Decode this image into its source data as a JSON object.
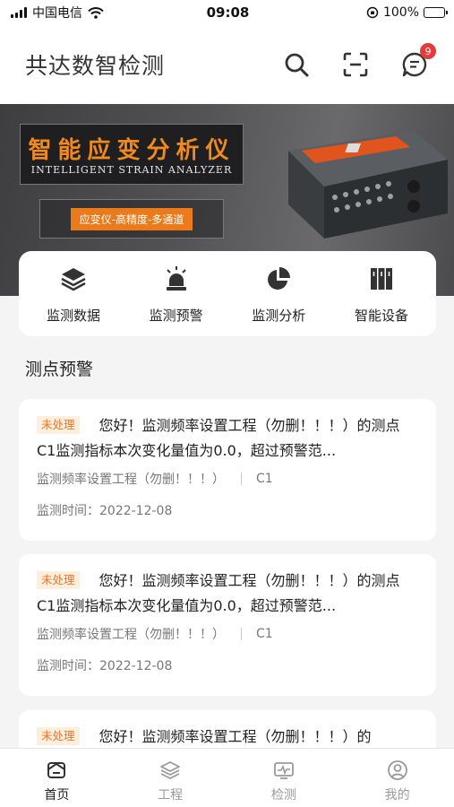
{
  "status_bar": {
    "carrier": "中国电信",
    "time": "09:08",
    "battery_pct": "100%",
    "battery_level": 1.0
  },
  "header": {
    "title": "共达数智检测",
    "notification_badge": "9",
    "icons": [
      "search-icon",
      "scan-icon",
      "message-icon"
    ]
  },
  "banner": {
    "title": "智能应变分析仪",
    "subtitle": "INTELLIGENT STRAIN ANALYZER",
    "tag": "应变仪-高精度-多通道"
  },
  "quick_nav": [
    {
      "label": "监测数据",
      "icon": "layers-icon"
    },
    {
      "label": "监测预警",
      "icon": "alarm-light-icon"
    },
    {
      "label": "监测分析",
      "icon": "pie-chart-icon"
    },
    {
      "label": "智能设备",
      "icon": "device-cabinet-icon"
    }
  ],
  "section": {
    "title": "测点预警"
  },
  "alerts": [
    {
      "status": "未处理",
      "message": "您好！监测频率设置工程（勿删！！！）的测点C1监测指标本次变化量值为0.0，超过预警范...",
      "project": "监测频率设置工程（勿删！！！）",
      "point": "C1",
      "time": "监测时间：2022-12-08"
    },
    {
      "status": "未处理",
      "message": "您好！监测频率设置工程（勿删！！！）的测点C1监测指标本次变化量值为0.0，超过预警范...",
      "project": "监测频率设置工程（勿删！！！）",
      "point": "C1",
      "time": "监测时间：2022-12-08"
    },
    {
      "status": "未处理",
      "message": "您好！监测频率设置工程（勿删！！！）的"
    }
  ],
  "tab_bar": [
    {
      "label": "首页",
      "icon": "home-icon",
      "active": true
    },
    {
      "label": "工程",
      "icon": "layers-icon",
      "active": false
    },
    {
      "label": "检测",
      "icon": "monitor-icon",
      "active": false
    },
    {
      "label": "我的",
      "icon": "user-icon",
      "active": false
    }
  ],
  "colors": {
    "accent_orange": "#ea7a1a",
    "badge_red": "#e43b3b",
    "tag_bg": "#fdeedd",
    "tag_text": "#e9762a"
  }
}
